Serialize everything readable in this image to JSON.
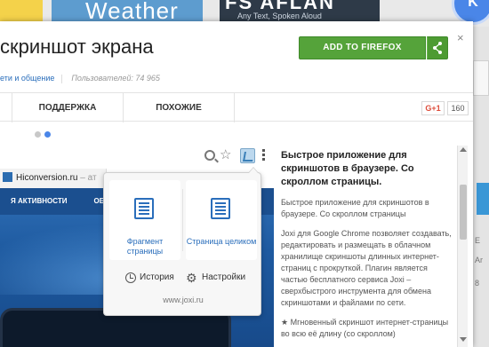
{
  "background": {
    "tiles": {
      "weather": "Weather",
      "promo_big": "FS AFLAN",
      "promo_small": "Any Text, Spoken Aloud",
      "avatar_letter": "K"
    },
    "right_rail": {
      "line1": "E",
      "line2": "Ar",
      "line3": "8"
    }
  },
  "dialog": {
    "title": "скриншот экрана",
    "category_link": "ети и общение",
    "users": "Пользователей: 74 965",
    "add_button": "ADD TO FIREFOX",
    "close": "×",
    "tabs": {
      "support": "ПОДДЕРЖКА",
      "similar": "ПОХОЖИЕ"
    },
    "gplus": {
      "label": "G+1",
      "count": "160"
    }
  },
  "screenshot": {
    "site_tab": {
      "title": "Hiconversion.ru",
      "suffix": " – ат"
    },
    "site_nav": {
      "item1": "Я АКТИВНОСТИ",
      "item2": "ОБЗОР"
    },
    "popup": {
      "fragment_label": "Фрагмент страницы",
      "page_label": "Страница целиком",
      "history": "История",
      "settings": "Настройки",
      "url": "www.joxi.ru"
    }
  },
  "description": {
    "heading": "Быстрое приложение для скриншотов в браузере. Со скроллом страницы.",
    "para1": "Быстрое приложение для скриншотов в браузере. Со скроллом страницы",
    "para2": "Joxi для Google Chrome позволяет создавать, редактировать и размещать в облачном хранилище скриншоты длинных интернет-страниц с прокруткой. Плагин является частью бесплатного сервиса Joxi – сверхбыстрого инструмента для обмена скриншотами и файлами по сети.",
    "para3": "★ Мгновенный скриншот интернет-страницы во всю её длину (со скроллом)"
  },
  "colors": {
    "add_button": "#55a33a",
    "link": "#2a6ebb",
    "active_dot": "#4a86e8",
    "gplus": "#dd4b39"
  },
  "icons": [
    "share-icon",
    "close-icon",
    "search-icon",
    "star-icon",
    "joxi-icon",
    "more-icon",
    "document-icon",
    "clock-icon",
    "gear-icon"
  ]
}
